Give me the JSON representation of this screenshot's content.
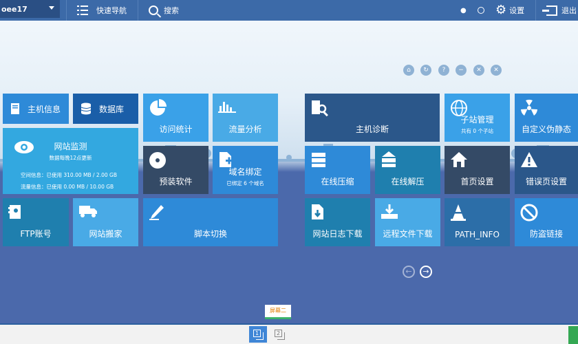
{
  "topbar": {
    "site_name": "oee17",
    "quick_nav": "快速导航",
    "search": "搜索",
    "settings": "设置",
    "logout": "退出"
  },
  "controls": [
    "home-icon",
    "refresh-icon",
    "help-icon",
    "minimize-icon",
    "fullscreen-icon",
    "close-icon"
  ],
  "tiles": {
    "host_info": "主机信息",
    "database": "数据库",
    "visit_stats": "访问统计",
    "traffic": "流量分析",
    "site_monitor": "网站监测",
    "site_monitor_sub": "数据每晚12点更新",
    "space_info": "空间信息：已使用 310.00 MB / 2.00 GB",
    "traffic_info": "流量信息：已使用 0.00 MB / 10.00 GB",
    "preinstall": "预装软件",
    "domain_bind": "域名绑定",
    "domain_bind_sub": "已绑定 6 个域名",
    "ftp": "FTP账号",
    "site_move": "网站搬家",
    "script_switch": "脚本切换",
    "host_diag": "主机诊断",
    "subsite": "子站管理",
    "subsite_sub": "共有 0 个子站",
    "pseudo_static": "自定义伪静态",
    "compress": "在线压缩",
    "decompress": "在线解压",
    "homepage": "首页设置",
    "error_page": "错误页设置",
    "log_download": "网站日志下载",
    "remote_download": "远程文件下载",
    "path_info": "PATH_INFO",
    "hotlink": "防盗链接"
  },
  "dock": {
    "tooltip": "屏幕二",
    "screen1": "1",
    "screen2": "2"
  }
}
